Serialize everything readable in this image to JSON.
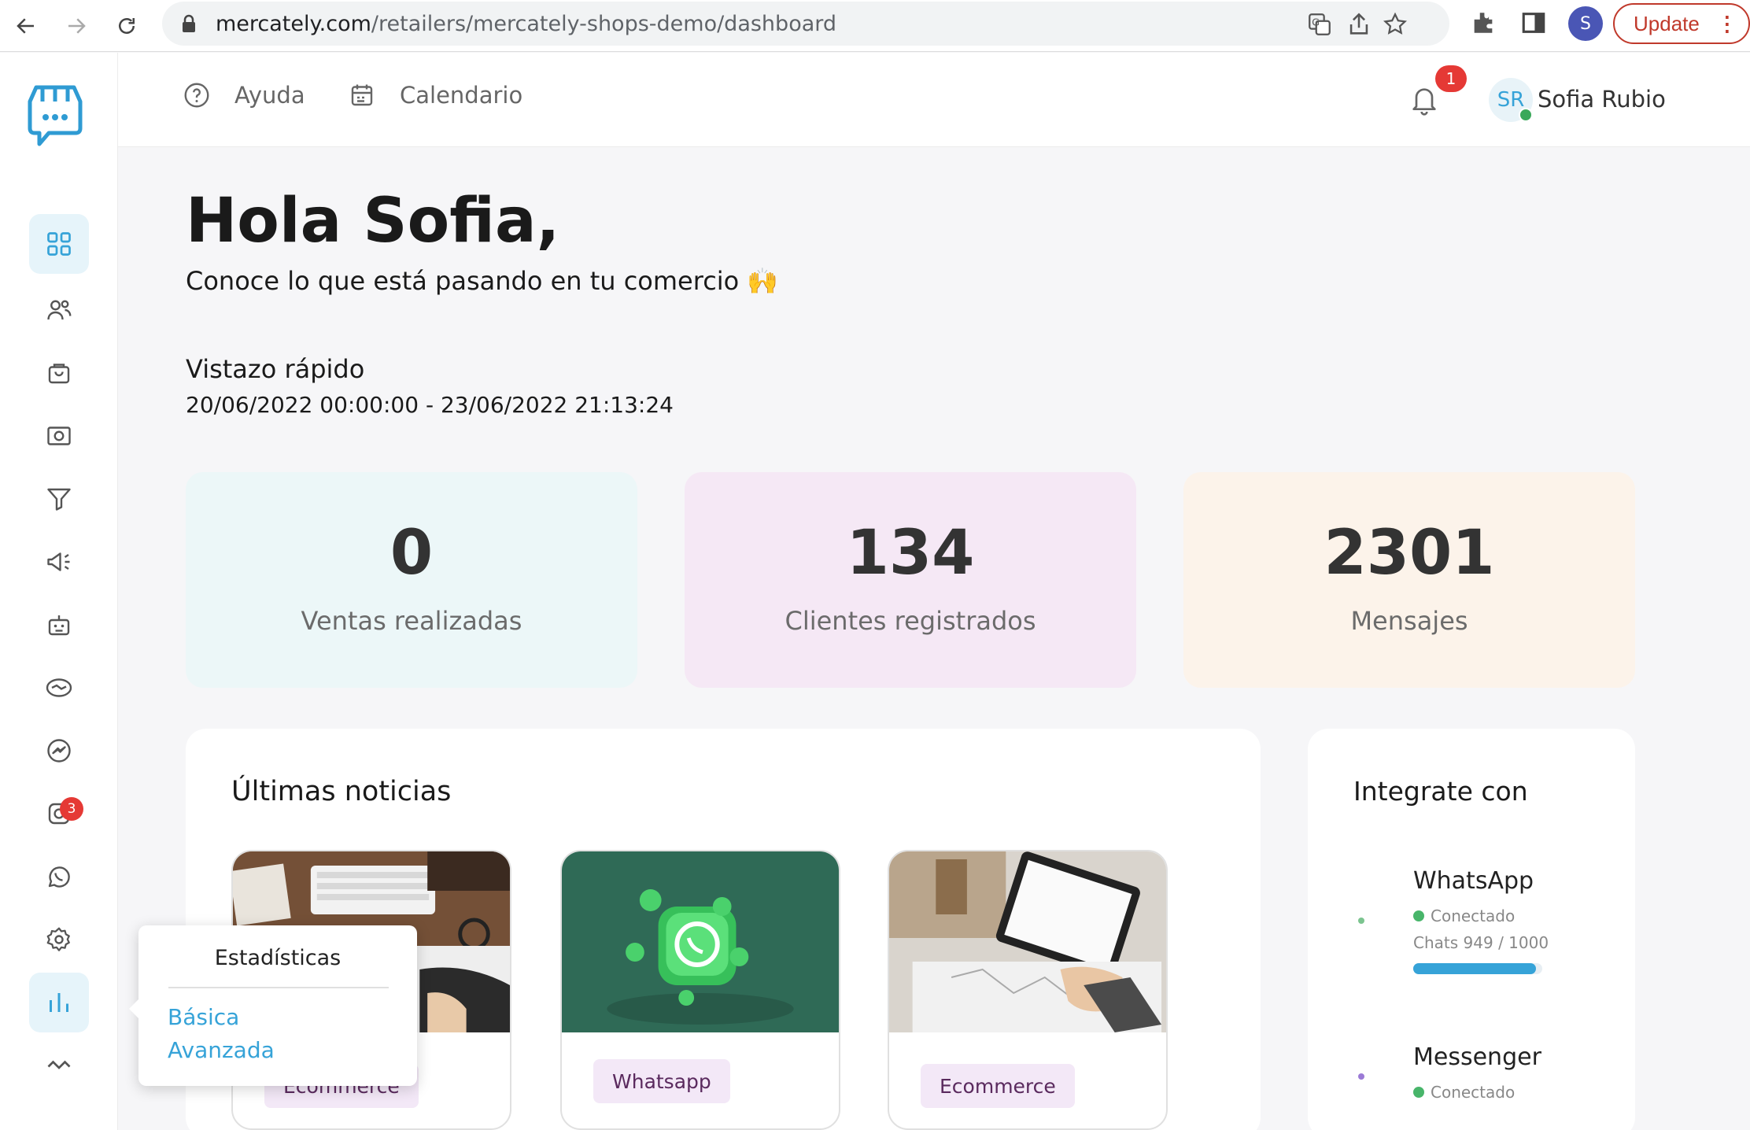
{
  "browser": {
    "url_host": "mercately.com",
    "url_path": "/retailers/mercately-shops-demo/dashboard",
    "profile_initial": "S",
    "update_label": "Update"
  },
  "header": {
    "help_label": "Ayuda",
    "calendar_label": "Calendario",
    "notification_count": "1",
    "user_initials": "SR",
    "user_name": "Sofia Rubio"
  },
  "sidebar": {
    "whatsapp_badge": "3"
  },
  "main": {
    "greeting": "Hola Sofia,",
    "subgreeting": "Conoce lo que está pasando en tu comercio 🙌",
    "quick_title": "Vistazo rápido",
    "quick_range": "20/06/2022 00:00:00 - 23/06/2022 21:13:24"
  },
  "stats": [
    {
      "value": "0",
      "label": "Ventas realizadas",
      "bg": "#ecf7f8"
    },
    {
      "value": "134",
      "label": "Clientes registrados",
      "bg": "#f5e8f5"
    },
    {
      "value": "2301",
      "label": "Mensajes",
      "bg": "#fcf3ea"
    }
  ],
  "news": {
    "title": "Últimas noticias",
    "cards": [
      {
        "tag": "Ecommerce"
      },
      {
        "tag": "Whatsapp"
      },
      {
        "tag": "Ecommerce"
      }
    ]
  },
  "integrations": {
    "title": "Integrate con",
    "items": [
      {
        "name": "WhatsApp",
        "status": "Conectado",
        "chats_label": "Chats",
        "chats_value": "949 / 1000",
        "progress": 0.95
      },
      {
        "name": "Messenger",
        "status": "Conectado"
      }
    ]
  },
  "popover": {
    "title": "Estadísticas",
    "options": [
      "Básica",
      "Avanzada"
    ]
  }
}
